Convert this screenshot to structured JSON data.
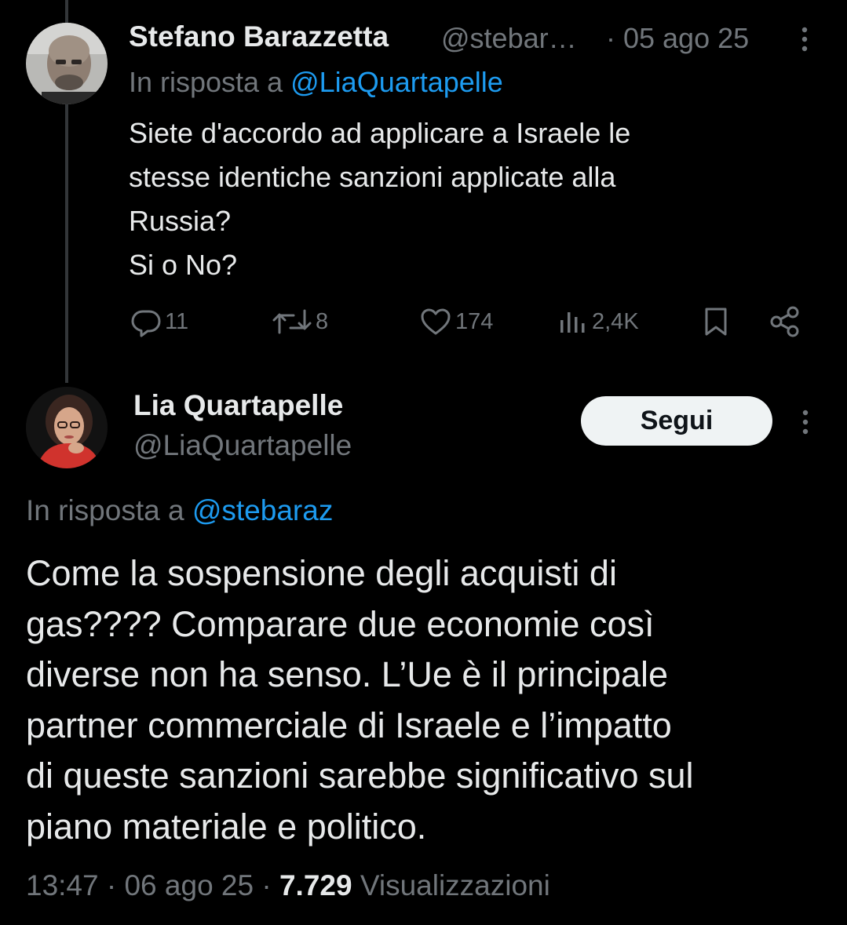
{
  "parent_tweet": {
    "author_name": "Stefano Barazzetta",
    "author_handle": "@stebar…",
    "date": "· 05 ago 25",
    "reply_prefix": "In risposta a ",
    "reply_to": "@LiaQuartapelle",
    "text": "Siete d'accordo ad applicare a Israele le\nstesse identiche sanzioni applicate alla\nRussia?\nSi o No?",
    "replies": "11",
    "reposts": "8",
    "likes": "174",
    "views": "2,4K",
    "icons": [
      "more-icon",
      "reply-icon",
      "repost-icon",
      "like-icon",
      "views-icon",
      "bookmark-icon",
      "share-icon"
    ]
  },
  "main_tweet": {
    "author_name": "Lia Quartapelle",
    "author_handle": "@LiaQuartapelle",
    "follow_label": "Segui",
    "reply_prefix": "In risposta a ",
    "reply_to": "@stebaraz",
    "text": "Come la sospensione degli acquisti di\ngas???? Comparare due economie così\ndiverse non ha senso. L’Ue è il principale\npartner commerciale di Israele e l’impatto\ndi queste sanzioni sarebbe significativo sul\npiano materiale e politico.",
    "time": "13:47",
    "separator": " · ",
    "date": "06 ago 25",
    "view_count": "7.729",
    "views_label": " Visualizzazioni"
  },
  "colors": {
    "background": "#000000",
    "text_primary": "#e7e9ea",
    "text_secondary": "#71767b",
    "link": "#1d9bf0",
    "button_bg": "#eff3f4"
  }
}
